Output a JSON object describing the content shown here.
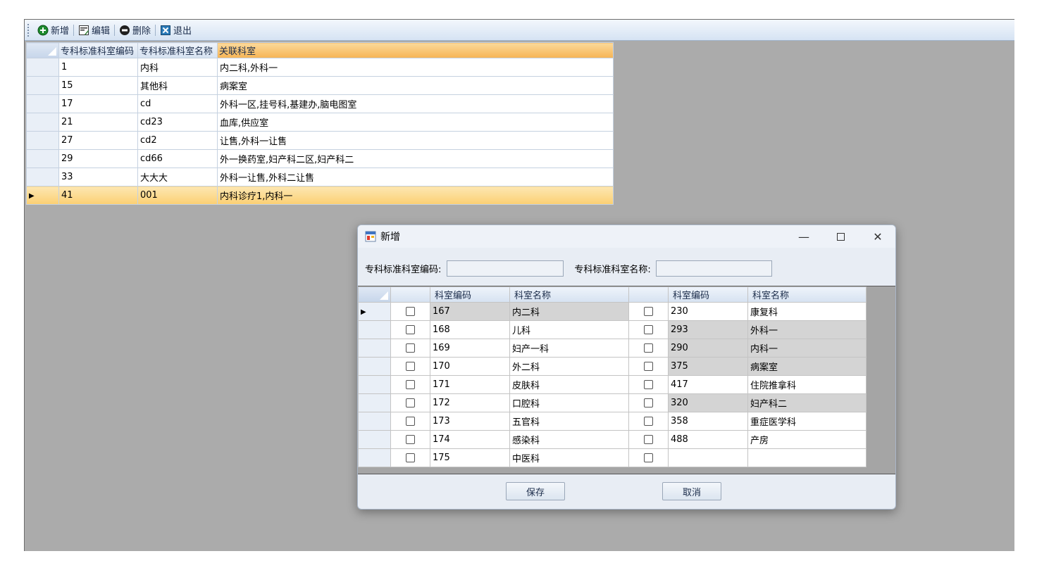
{
  "toolbar": {
    "buttons": [
      {
        "label": "新增",
        "icon": "add-circle-icon"
      },
      {
        "label": "编辑",
        "icon": "edit-icon"
      },
      {
        "label": "删除",
        "icon": "delete-circle-icon"
      },
      {
        "label": "退出",
        "icon": "exit-icon"
      }
    ]
  },
  "main_grid": {
    "columns": [
      "专科标准科室编码",
      "专科标准科室名称",
      "关联科室"
    ],
    "rows": [
      [
        "1",
        "内科",
        "内二科,外科一"
      ],
      [
        "15",
        "其他科",
        "病案室"
      ],
      [
        "17",
        "cd",
        "外科一区,挂号科,基建办,脑电图室"
      ],
      [
        "21",
        "cd23",
        "血库,供应室"
      ],
      [
        "27",
        "cd2",
        "让售,外科一让售"
      ],
      [
        "29",
        "cd66",
        "外一换药室,妇产科二区,妇产科二"
      ],
      [
        "33",
        "大大大",
        "外科一让售,外科二让售"
      ],
      [
        "41",
        "001",
        "内科诊疗1,内科一"
      ]
    ],
    "selected_row": 7
  },
  "dialog": {
    "title": "新增",
    "code_label": "专科标准科室编码:",
    "code_value": "",
    "name_label": "专科标准科室名称:",
    "name_value": "",
    "grid": {
      "columns": [
        "科室编码",
        "科室名称",
        "科室编码",
        "科室名称"
      ],
      "rows": [
        {
          "left_code": "167",
          "left_name": "内二科",
          "right_code": "230",
          "right_name": "康复科"
        },
        {
          "left_code": "168",
          "left_name": "儿科",
          "right_code": "293",
          "right_name": "外科一"
        },
        {
          "left_code": "169",
          "left_name": "妇产一科",
          "right_code": "290",
          "right_name": "内科一"
        },
        {
          "left_code": "170",
          "left_name": "外二科",
          "right_code": "375",
          "right_name": "病案室"
        },
        {
          "left_code": "171",
          "left_name": "皮肤科",
          "right_code": "417",
          "right_name": "住院推拿科"
        },
        {
          "left_code": "172",
          "left_name": "口腔科",
          "right_code": "320",
          "right_name": "妇产科二"
        },
        {
          "left_code": "173",
          "left_name": "五官科",
          "right_code": "358",
          "right_name": "重症医学科"
        },
        {
          "left_code": "174",
          "left_name": "感染科",
          "right_code": "488",
          "right_name": "产房"
        },
        {
          "left_code": "175",
          "left_name": "中医科",
          "right_code": "",
          "right_name": ""
        }
      ]
    },
    "save_label": "保存",
    "cancel_label": "取消"
  }
}
